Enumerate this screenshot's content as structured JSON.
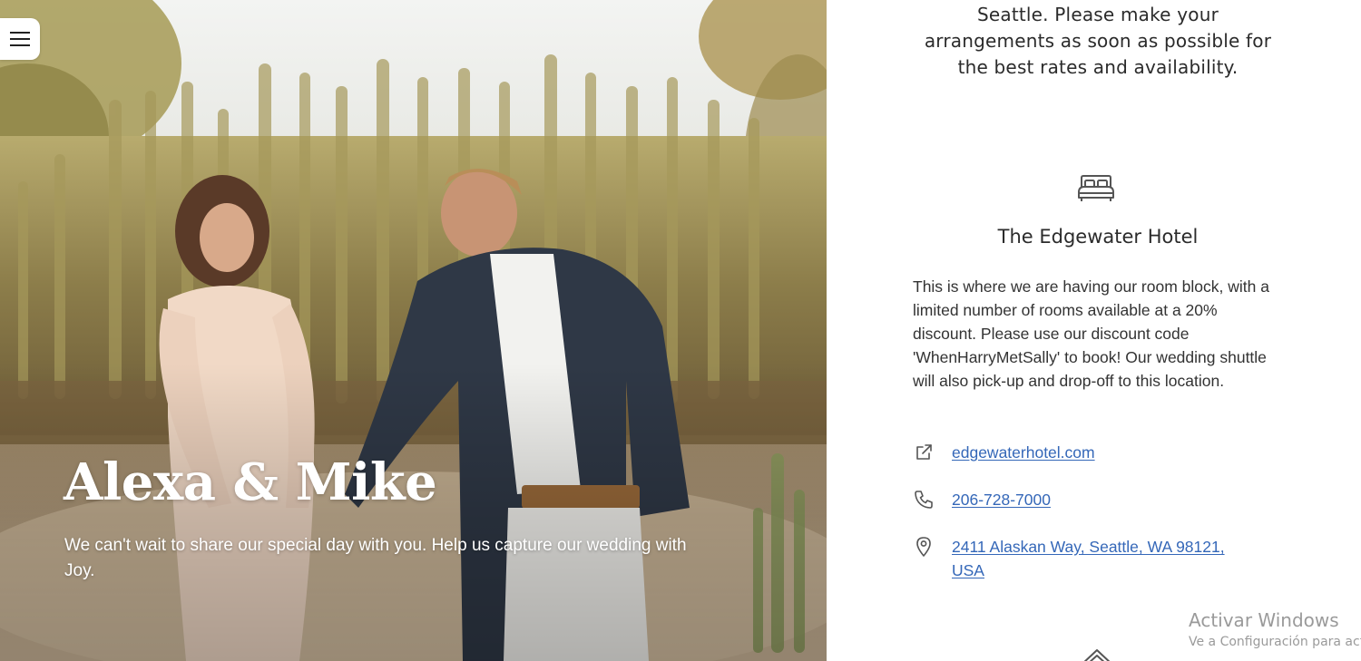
{
  "hero": {
    "menu_icon": "hamburger-menu-icon",
    "couple_name": "Alexa & Mike",
    "tagline": "We can't wait to share our special day with you. Help us capture our wedding with Joy."
  },
  "info": {
    "intro_text": "Seattle. Please make your arrangements as soon as possible for the best rates and availability.",
    "hotel": {
      "icon": "bed-icon",
      "name": "The Edgewater Hotel",
      "description": "This is where we are having our room block, with a limited number of rooms available at a 20% discount. Please use our discount code 'WhenHarryMetSally' to book! Our wedding shuttle will also pick-up and drop-off to this location.",
      "website": {
        "icon": "external-link-icon",
        "label": "edgewaterhotel.com"
      },
      "phone": {
        "icon": "phone-icon",
        "label": "206-728-7000"
      },
      "address": {
        "icon": "map-pin-icon",
        "label": "2411 Alaskan Way, Seattle, WA 98121, USA"
      }
    },
    "next_icon": "house-icon"
  },
  "watermark": {
    "title": "Activar Windows",
    "subtitle": "Ve a Configuración para activar Windows."
  },
  "colors": {
    "link": "#3467b8",
    "text": "#2b2b2b",
    "icon": "#555555"
  }
}
